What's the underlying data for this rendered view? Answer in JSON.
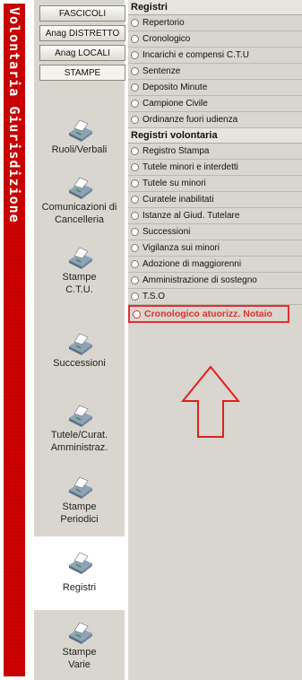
{
  "side_banner": "Volontaria Giurisdizione",
  "tabs": [
    {
      "label": "FASCICOLI",
      "selected": false
    },
    {
      "label": "Anag DISTRETTO",
      "selected": false
    },
    {
      "label": "Anag LOCALI",
      "selected": false
    },
    {
      "label": "STAMPE",
      "selected": true
    }
  ],
  "nav": [
    {
      "label": "Ruoli/Verbali",
      "icon": "printer-icon",
      "selected": false
    },
    {
      "label": "Comunicazioni di Cancelleria",
      "icon": "printer-icon",
      "selected": false
    },
    {
      "label": "Stampe C.T.U.",
      "icon": "printer-icon",
      "selected": false
    },
    {
      "label": "Successioni",
      "icon": "printer-icon",
      "selected": false
    },
    {
      "label": "Tutele/Curat. Amministraz.",
      "icon": "printer-icon",
      "selected": false
    },
    {
      "label": "Stampe Periodici",
      "icon": "printer-icon",
      "selected": false
    },
    {
      "label": "Registri",
      "icon": "printer-icon",
      "selected": true
    },
    {
      "label": "Stampe Varie",
      "icon": "printer-icon",
      "selected": false
    }
  ],
  "registri": {
    "title": "Registri",
    "items": [
      "Repertorio",
      "Cronologico",
      "Incarichi e compensi C.T.U",
      "Sentenze",
      "Deposito Minute",
      "Campione Civile",
      "Ordinanze fuori udienza"
    ]
  },
  "volontaria": {
    "title": "Registri volontaria",
    "items": [
      "Registro Stampa",
      "Tutele minori e interdetti",
      "Tutele su minori",
      "Curatele inabilitati",
      "Istanze al Giud. Tutelare",
      "Successioni",
      "Vigilanza sui minori",
      "Adozione di maggiorenni",
      "Amministrazione di sostegno",
      "T.S.O"
    ],
    "highlighted": "Cronologico atuorizz. Notaio"
  },
  "colors": {
    "banner": "#cc0000",
    "highlight": "#e03030",
    "panel": "#d8d6ce"
  }
}
